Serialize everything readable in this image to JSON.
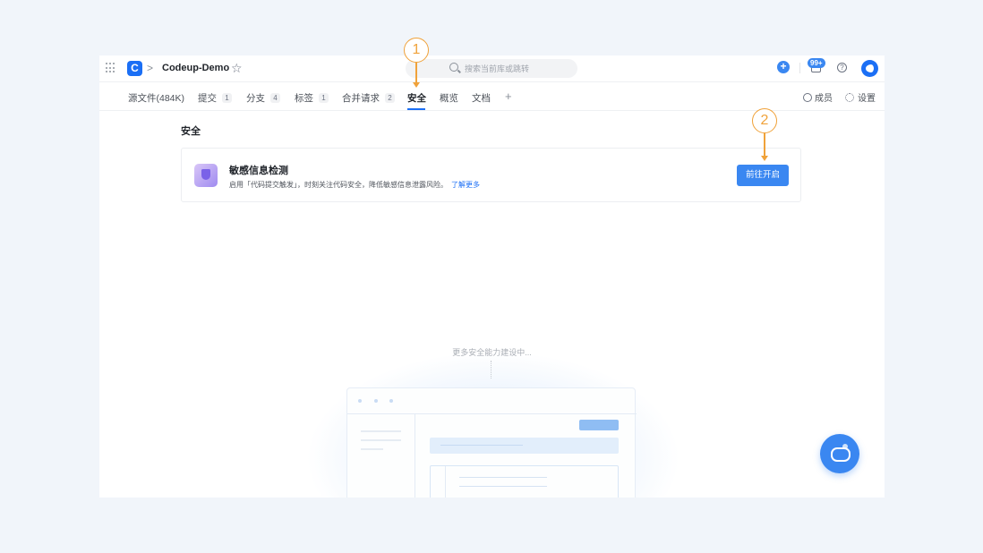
{
  "header": {
    "repo_name": "Codeup-Demo",
    "breadcrumb_separator": ">",
    "logo_glyph": "C",
    "search_placeholder": "搜索当前库或跳转",
    "notification_badge": "99+",
    "add_glyph": "+",
    "help_glyph": "?",
    "star_glyph": "☆"
  },
  "tabs": [
    {
      "label": "源文件(484K)",
      "count": ""
    },
    {
      "label": "提交",
      "count": "1"
    },
    {
      "label": "分支",
      "count": "4"
    },
    {
      "label": "标签",
      "count": "1"
    },
    {
      "label": "合并请求",
      "count": "2"
    },
    {
      "label": "安全",
      "count": "",
      "active": true
    },
    {
      "label": "概览",
      "count": ""
    },
    {
      "label": "文档",
      "count": ""
    }
  ],
  "tab_add_glyph": "+",
  "right_links": {
    "members": "成员",
    "settings": "设置"
  },
  "content": {
    "section_title": "安全",
    "card": {
      "title": "敏感信息检测",
      "description": "启用「代码提交触发」，时刻关注代码安全，降低敏感信息泄露风险。",
      "link": "了解更多",
      "button": "前往开启"
    },
    "building_text": "更多安全能力建设中..."
  },
  "annotations": [
    "1",
    "2"
  ],
  "colors": {
    "accent": "#1b6ff5",
    "button": "#3a87f1",
    "annotation": "#f0a23a",
    "background": "#f1f5fa"
  },
  "icons": [
    "apps-icon",
    "star-icon",
    "search-icon",
    "plus-icon",
    "bell-icon",
    "help-icon",
    "avatar",
    "member-icon",
    "gear-icon",
    "shield-icon",
    "chat-icon"
  ]
}
